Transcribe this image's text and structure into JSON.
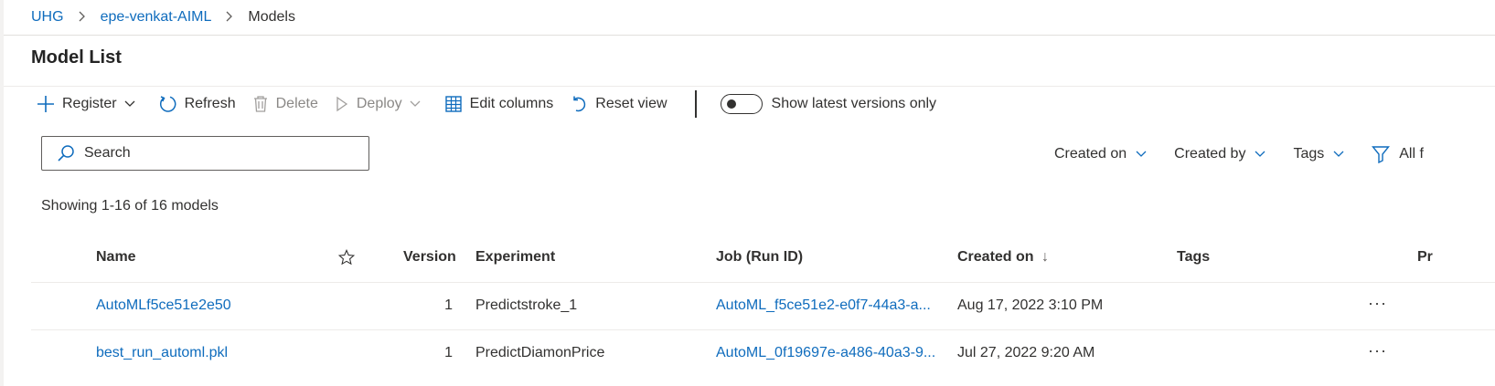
{
  "breadcrumb": {
    "items": [
      "UHG",
      "epe-venkat-AIML",
      "Models"
    ]
  },
  "page": {
    "title": "Model List"
  },
  "toolbar": {
    "register": "Register",
    "refresh": "Refresh",
    "delete": "Delete",
    "deploy": "Deploy",
    "edit_columns": "Edit columns",
    "reset_view": "Reset view",
    "toggle_label": "Show latest versions only",
    "toggle_on": false
  },
  "search": {
    "placeholder": "Search"
  },
  "filters": {
    "created_on": "Created on",
    "created_by": "Created by",
    "tags": "Tags",
    "all_filters": "All f"
  },
  "results": {
    "count_text": "Showing 1-16 of 16 models"
  },
  "table": {
    "columns": {
      "name": "Name",
      "version": "Version",
      "experiment": "Experiment",
      "job": "Job (Run ID)",
      "created_on": "Created on",
      "sort_indicator": "↓",
      "tags": "Tags",
      "properties": "Pr"
    },
    "rows": [
      {
        "name": "AutoMLf5ce51e2e50",
        "version": "1",
        "experiment": "Predictstroke_1",
        "job": "AutoML_f5ce51e2-e0f7-44a3-a...",
        "created_on": "Aug 17, 2022 3:10 PM",
        "tags": "",
        "more": "···"
      },
      {
        "name": "best_run_automl.pkl",
        "version": "1",
        "experiment": "PredictDiamonPrice",
        "job": "AutoML_0f19697e-a486-40a3-9...",
        "created_on": "Jul 27, 2022 9:20 AM",
        "tags": "",
        "more": "···"
      }
    ]
  },
  "colors": {
    "accent": "#0f6cbd",
    "text": "#323130",
    "disabled": "#8a8886",
    "divider": "#edebe9"
  }
}
